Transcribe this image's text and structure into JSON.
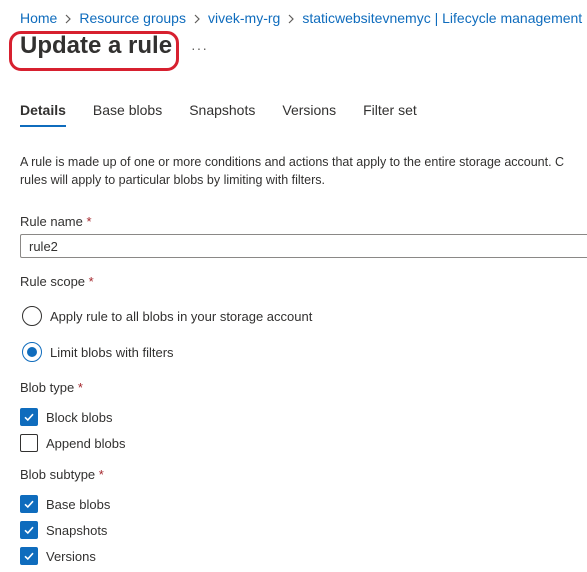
{
  "breadcrumb": {
    "items": [
      "Home",
      "Resource groups",
      "vivek-my-rg",
      "staticwebsitevnemyc | Lifecycle management"
    ]
  },
  "header": {
    "title": "Update a rule",
    "more_label": "···"
  },
  "tabs": [
    {
      "label": "Details",
      "active": true
    },
    {
      "label": "Base blobs",
      "active": false
    },
    {
      "label": "Snapshots",
      "active": false
    },
    {
      "label": "Versions",
      "active": false
    },
    {
      "label": "Filter set",
      "active": false
    }
  ],
  "description": {
    "line1": "A rule is made up of one or more conditions and actions that apply to the entire storage account. C",
    "line2": "rules will apply to particular blobs by limiting with filters."
  },
  "rule_name": {
    "label": "Rule name",
    "required_mark": "*",
    "value": "rule2"
  },
  "rule_scope": {
    "label": "Rule scope",
    "required_mark": "*",
    "options": [
      {
        "label": "Apply rule to all blobs in your storage account",
        "selected": false
      },
      {
        "label": "Limit blobs with filters",
        "selected": true
      }
    ]
  },
  "blob_type": {
    "label": "Blob type",
    "required_mark": "*",
    "options": [
      {
        "label": "Block blobs",
        "checked": true
      },
      {
        "label": "Append blobs",
        "checked": false
      }
    ]
  },
  "blob_subtype": {
    "label": "Blob subtype",
    "required_mark": "*",
    "options": [
      {
        "label": "Base blobs",
        "checked": true
      },
      {
        "label": "Snapshots",
        "checked": true
      },
      {
        "label": "Versions",
        "checked": true
      }
    ]
  },
  "colors": {
    "accent": "#0f6cbd",
    "highlight_outline": "#d7202f",
    "required": "#a4262c"
  }
}
